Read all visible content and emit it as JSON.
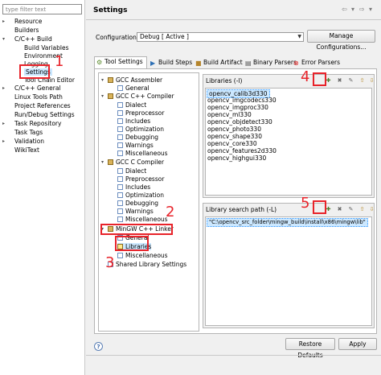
{
  "filter": {
    "placeholder": "type filter text"
  },
  "left_nav": {
    "resource": "Resource",
    "builders": "Builders",
    "cpp_build": "C/C++ Build",
    "build_variables": "Build Variables",
    "environment": "Environment",
    "logging": "Logging",
    "settings": "Settings",
    "tool_chain_editor": "Tool Chain Editor",
    "cpp_general": "C/C++ General",
    "linux_tools_path": "Linux Tools Path",
    "project_references": "Project References",
    "run_debug_settings": "Run/Debug Settings",
    "task_repository": "Task Repository",
    "task_tags": "Task Tags",
    "validation": "Validation",
    "wikitext": "WikiText"
  },
  "header": {
    "title": "Settings"
  },
  "config": {
    "label": "Configuration:",
    "value": "Debug  [ Active ]",
    "manage_button": "Manage Configurations..."
  },
  "tabs": [
    {
      "label": "Tool Settings",
      "icon": "tool-settings-icon"
    },
    {
      "label": "Build Steps",
      "icon": "build-steps-icon"
    },
    {
      "label": "Build Artifact",
      "icon": "build-artifact-icon"
    },
    {
      "label": "Binary Parsers",
      "icon": "binary-parsers-icon"
    },
    {
      "label": "Error Parsers",
      "icon": "error-parsers-icon"
    }
  ],
  "tool_tree": {
    "gcc_assembler": "GCC Assembler",
    "asm_general": "General",
    "gcc_cpp_compiler": "GCC C++ Compiler",
    "cpp_dialect": "Dialect",
    "cpp_preprocessor": "Preprocessor",
    "cpp_includes": "Includes",
    "cpp_optimization": "Optimization",
    "cpp_debugging": "Debugging",
    "cpp_warnings": "Warnings",
    "cpp_misc": "Miscellaneous",
    "gcc_c_compiler": "GCC C Compiler",
    "c_dialect": "Dialect",
    "c_preprocessor": "Preprocessor",
    "c_includes": "Includes",
    "c_optimization": "Optimization",
    "c_debugging": "Debugging",
    "c_warnings": "Warnings",
    "c_misc": "Miscellaneous",
    "mingw_linker": "MinGW C++ Linker",
    "linker_general": "General",
    "linker_libraries": "Libraries",
    "linker_misc": "Miscellaneous",
    "shared_lib_settings": "Shared Library Settings"
  },
  "libraries": {
    "label": "Libraries (-l)",
    "items": [
      "opencv_calib3d330",
      "opencv_imgcodecs330",
      "opencv_imgproc330",
      "opencv_ml330",
      "opencv_objdetect330",
      "opencv_photo330",
      "opencv_shape330",
      "opencv_core330",
      "opencv_features2d330",
      "opencv_highgui330"
    ]
  },
  "library_search_path": {
    "label": "Library search path (-L)",
    "items": [
      "\"C:\\opencv_src_folder\\mingw_build\\install\\x86\\mingw\\lib\""
    ]
  },
  "buttons": {
    "restore_defaults": "Restore Defaults",
    "apply": "Apply"
  },
  "annotations": [
    "1",
    "2",
    "3",
    "4",
    "5"
  ],
  "colors": {
    "annotation": "#e8232a",
    "selection": "#cce8ff"
  }
}
